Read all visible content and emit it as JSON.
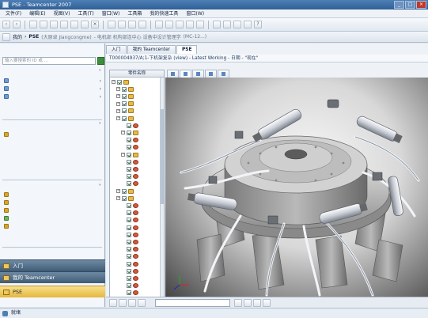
{
  "app": {
    "title": "PSE - Teamcenter 2007"
  },
  "window_controls": {
    "minimize": "_",
    "maximize": "□",
    "close": "×"
  },
  "menu": [
    "文件(F)",
    "编辑(E)",
    "视图(V)",
    "工具(T)",
    "窗口(W)",
    "工具箱",
    "我的快速工具",
    "窗口(W)"
  ],
  "breadcrumb": {
    "home": "我的",
    "app": "PSE",
    "user": "(大原卓 Jiangcongme)",
    "path": "- 电机部 机构部连中心 设备中设计管理学",
    "code": "(MC-12...)"
  },
  "left_panel": {
    "search_placeholder": "输入要搜索的 ID 或 ..."
  },
  "status": {
    "text": "就绪"
  },
  "main_tabs": [
    "入门",
    "我的 Teamcenter",
    "PSE"
  ],
  "object_line": "T000004937/A;1-下机架复杂 (view) - Latest Working - 日期 - \"现在\"",
  "tree": {
    "header": "零件名称"
  }
}
